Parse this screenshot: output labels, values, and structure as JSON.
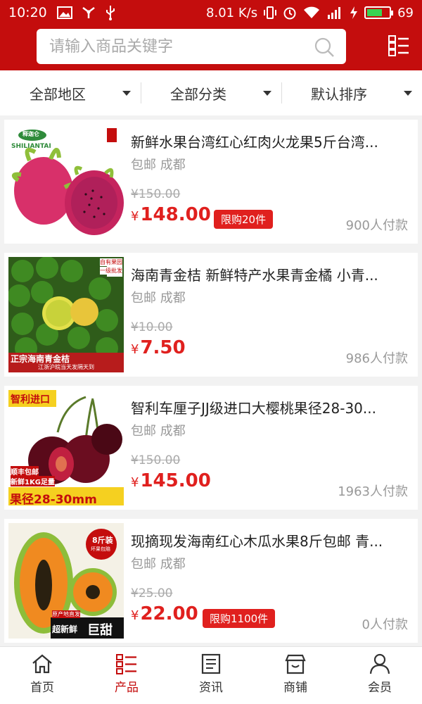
{
  "status_bar": {
    "time": "10:20",
    "speed": "8.01 K/s",
    "battery": "69",
    "battery_level": 0.69
  },
  "search": {
    "placeholder": "请输入商品关键字"
  },
  "filters": [
    {
      "label": "全部地区"
    },
    {
      "label": "全部分类"
    },
    {
      "label": "默认排序"
    }
  ],
  "thumb_text": {
    "p1_logo": "释迦仑",
    "p1_brand": "SHILIANTAI",
    "p2_corner_1": "自有果园",
    "p2_corner_2": "一级批发",
    "p2_banner": "正宗海南青金桔",
    "p2_sub": "江浙沪皖当天发隔天到",
    "p3_top": "智利进口",
    "p3_mid_1": "顺丰包邮",
    "p3_mid_2": "新鲜1KG足量",
    "p3_bottom": "果径28-30mm",
    "p4_badge_1": "8斤装",
    "p4_badge_2": "坏果包赔",
    "p4_small": "原产地直发",
    "p4_banner_a": "超新鲜",
    "p4_banner_b": "巨甜"
  },
  "products": [
    {
      "title": "新鲜水果台湾红心红肉火龙果5斤台湾...",
      "ship": "包邮 成都",
      "old_price": "¥150.00",
      "currency": "¥",
      "price": "148.00",
      "badge": "限购20件",
      "sold": "900人付款"
    },
    {
      "title": "海南青金桔 新鲜特产水果青金橘 小青...",
      "ship": "包邮 成都",
      "old_price": "¥10.00",
      "currency": "¥",
      "price": "7.50",
      "badge": "",
      "sold": "986人付款"
    },
    {
      "title": "智利车厘子JJ级进口大樱桃果径28-30...",
      "ship": "包邮 成都",
      "old_price": "¥150.00",
      "currency": "¥",
      "price": "145.00",
      "badge": "",
      "sold": "1963人付款"
    },
    {
      "title": "现摘现发海南红心木瓜水果8斤包邮 青...",
      "ship": "包邮 成都",
      "old_price": "¥25.00",
      "currency": "¥",
      "price": "22.00",
      "badge": "限购1100件",
      "sold": "0人付款"
    }
  ],
  "nav": [
    {
      "label": "首页",
      "icon": "home-icon"
    },
    {
      "label": "产品",
      "icon": "list-icon",
      "active": true
    },
    {
      "label": "资讯",
      "icon": "news-icon"
    },
    {
      "label": "商铺",
      "icon": "store-icon"
    },
    {
      "label": "会员",
      "icon": "user-icon"
    }
  ],
  "colors": {
    "brand_red": "#c40d0d",
    "price_red": "#e0201e"
  }
}
